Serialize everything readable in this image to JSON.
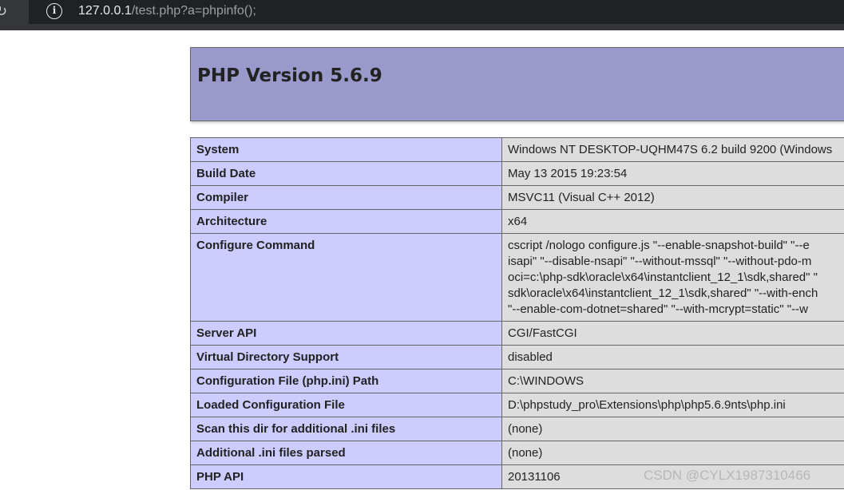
{
  "browser": {
    "url_host": "127.0.0.1",
    "url_path": "/test.php?a=phpinfo();",
    "reload_glyph": "↻",
    "info_glyph": "i"
  },
  "page": {
    "title": "PHP Version 5.6.9"
  },
  "rows": [
    {
      "key": "System",
      "value": "Windows NT DESKTOP-UQHM47S 6.2 build 9200 (Windows"
    },
    {
      "key": "Build Date",
      "value": "May 13 2015 19:23:54"
    },
    {
      "key": "Compiler",
      "value": "MSVC11 (Visual C++ 2012)"
    },
    {
      "key": "Architecture",
      "value": "x64"
    },
    {
      "key": "Configure Command",
      "lines": [
        "cscript /nologo configure.js \"--enable-snapshot-build\" \"--e",
        "isapi\" \"--disable-nsapi\" \"--without-mssql\" \"--without-pdo-m",
        "oci=c:\\php-sdk\\oracle\\x64\\instantclient_12_1\\sdk,shared\" \"",
        "sdk\\oracle\\x64\\instantclient_12_1\\sdk,shared\" \"--with-ench",
        "\"--enable-com-dotnet=shared\" \"--with-mcrypt=static\" \"--w"
      ]
    },
    {
      "key": "Server API",
      "value": "CGI/FastCGI"
    },
    {
      "key": "Virtual Directory Support",
      "value": "disabled"
    },
    {
      "key": "Configuration File (php.ini) Path",
      "value": "C:\\WINDOWS"
    },
    {
      "key": "Loaded Configuration File",
      "value": "D:\\phpstudy_pro\\Extensions\\php\\php5.6.9nts\\php.ini"
    },
    {
      "key": "Scan this dir for additional .ini files",
      "value": "(none)"
    },
    {
      "key": "Additional .ini files parsed",
      "value": "(none)"
    },
    {
      "key": "PHP API",
      "value": "20131106"
    }
  ],
  "watermark": "CSDN @CYLX1987310466"
}
